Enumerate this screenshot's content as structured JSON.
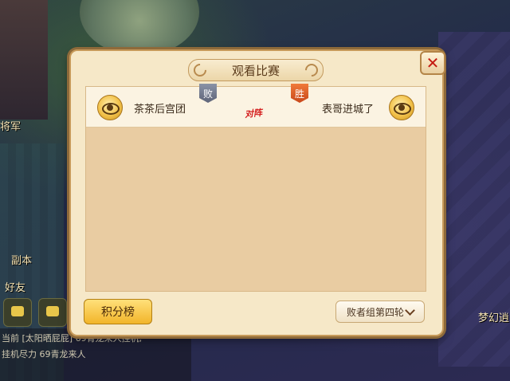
{
  "background": {
    "left_texts": [
      "将军",
      "副本",
      "好友"
    ],
    "right_text": "梦幻逍",
    "chat_lines": [
      "当前 [太阳晒屁屁] 69青龙来人挂机,",
      "挂机尽力        69青龙来人"
    ]
  },
  "dialog": {
    "title": "观看比赛",
    "close_icon": "close-icon",
    "matches": [
      {
        "left_team": "茶茶后宫团",
        "left_result": "败",
        "vs_label": "对阵",
        "right_team": "表哥进城了",
        "right_result": "胜"
      }
    ],
    "score_button": "积分榜",
    "round_select": "败者组第四轮"
  },
  "colors": {
    "panel": "#e9cca2",
    "row": "#fbf3e2",
    "win_badge": "#d8541e",
    "lose_badge": "#767d92",
    "close_x": "#c41b12"
  }
}
